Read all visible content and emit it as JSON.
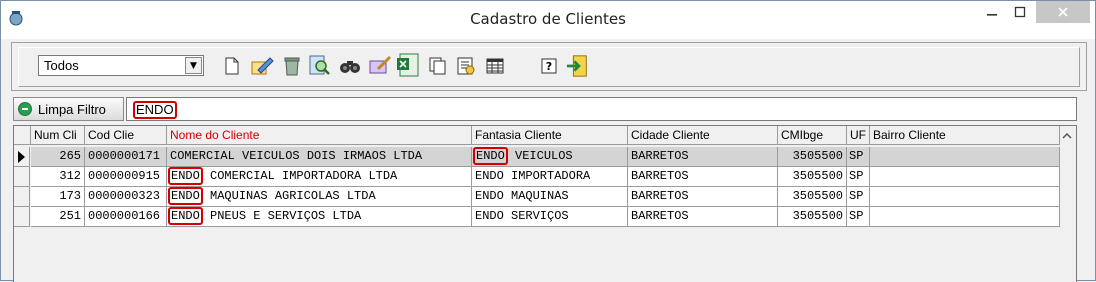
{
  "window": {
    "title": "Cadastro de Clientes"
  },
  "toolbar": {
    "filter_select": "Todos",
    "icons": [
      "new-icon",
      "edit-icon",
      "delete-icon",
      "find-icon",
      "search-icon",
      "tools-icon",
      "excel-icon",
      "copy-icon",
      "report-icon",
      "grid-icon",
      "help-icon",
      "exit-icon"
    ]
  },
  "filter": {
    "clear_label": "Limpa Filtro",
    "value": "ENDO"
  },
  "grid": {
    "columns": [
      "Num Cli",
      "Cod Clie",
      "Nome do Cliente",
      "Fantasia Cliente",
      "Cidade Cliente",
      "CMIbge",
      "UF",
      "Bairro Cliente"
    ],
    "rows": [
      {
        "num": "265",
        "cod": "0000000171",
        "nome_pre": "COMERCIAL VEICULOS DOIS IRMAOS LTDA",
        "nome_hl": "",
        "nome_post": "",
        "fant_hl": "ENDO",
        "fant_post": " VEICULOS",
        "cidade": "BARRETOS",
        "ibge": "3505500",
        "uf": "SP",
        "bairro": ""
      },
      {
        "num": "312",
        "cod": "0000000915",
        "nome_pre": "",
        "nome_hl": "ENDO",
        "nome_post": " COMERCIAL IMPORTADORA LTDA",
        "fant_hl": "",
        "fant_post": "ENDO IMPORTADORA",
        "cidade": "BARRETOS",
        "ibge": "3505500",
        "uf": "SP",
        "bairro": ""
      },
      {
        "num": "173",
        "cod": "0000000323",
        "nome_pre": "",
        "nome_hl": "ENDO",
        "nome_post": " MAQUINAS AGRICOLAS LTDA",
        "fant_hl": "",
        "fant_post": "ENDO MAQUINAS",
        "cidade": "BARRETOS",
        "ibge": "3505500",
        "uf": "SP",
        "bairro": ""
      },
      {
        "num": "251",
        "cod": "0000000166",
        "nome_pre": "",
        "nome_hl": "ENDO",
        "nome_post": " PNEUS E SERVIÇOS LTDA",
        "fant_hl": "",
        "fant_post": "ENDO SERVIÇOS",
        "cidade": "BARRETOS",
        "ibge": "3505500",
        "uf": "SP",
        "bairro": ""
      }
    ]
  },
  "colors": {
    "highlight": "#d40000",
    "selected_row": "#d4d4d4",
    "accent_red_text": "#d00000"
  }
}
